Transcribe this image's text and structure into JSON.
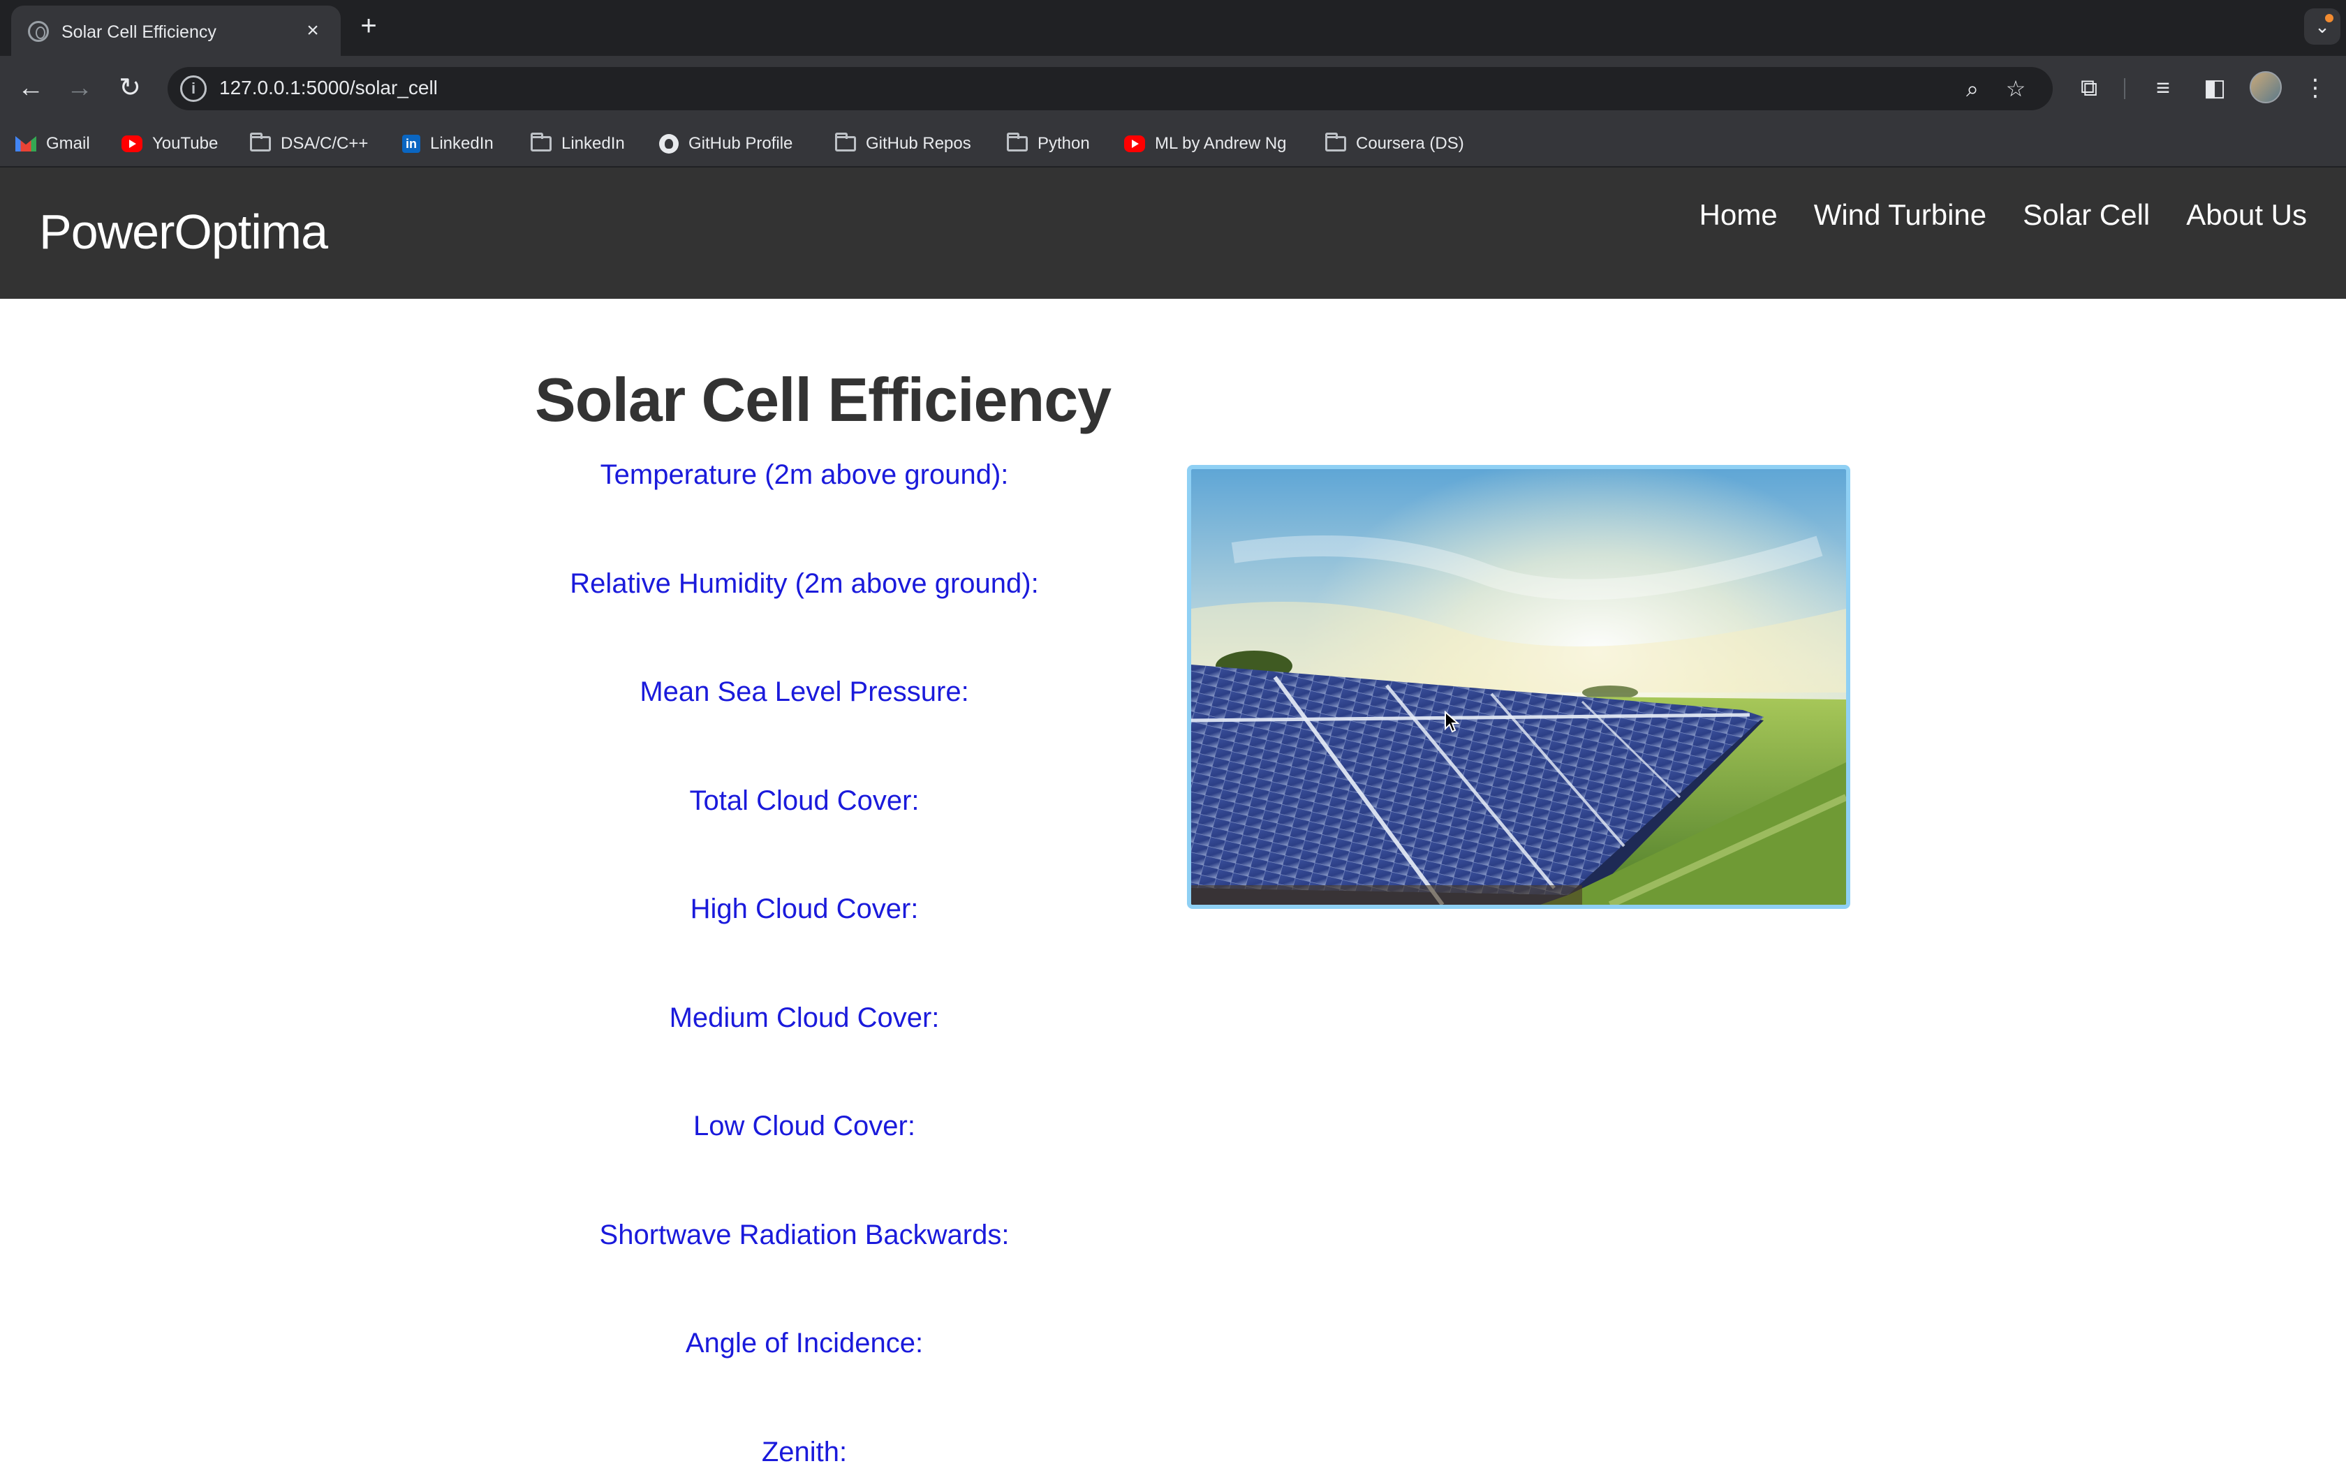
{
  "browser": {
    "tab": {
      "title": "Solar Cell Efficiency",
      "close": "×"
    },
    "new_tab": "+",
    "url": "127.0.0.1:5000/solar_cell",
    "bookmarks": [
      {
        "label": "Gmail",
        "icon": "gmail-icon"
      },
      {
        "label": "YouTube",
        "icon": "youtube-icon"
      },
      {
        "label": "DSA/C/C++",
        "icon": "folder-icon"
      },
      {
        "label": "LinkedIn",
        "icon": "linkedin-icon"
      },
      {
        "label": "LinkedIn",
        "icon": "folder-icon"
      },
      {
        "label": "GitHub Profile",
        "icon": "github-icon"
      },
      {
        "label": "GitHub Repos",
        "icon": "folder-icon"
      },
      {
        "label": "Python",
        "icon": "folder-icon"
      },
      {
        "label": "ML by Andrew Ng",
        "icon": "youtube-icon"
      },
      {
        "label": "Coursera (DS)",
        "icon": "folder-icon"
      }
    ]
  },
  "site": {
    "brand": "PowerOptima",
    "nav": [
      "Home",
      "Wind Turbine",
      "Solar Cell",
      "About Us"
    ]
  },
  "main": {
    "heading": "Solar Cell Efficiency",
    "fields": [
      "Temperature (2m above ground):",
      "Relative Humidity (2m above ground):",
      "Mean Sea Level Pressure:",
      "Total Cloud Cover:",
      "High Cloud Cover:",
      "Medium Cloud Cover:",
      "Low Cloud Cover:",
      "Shortwave Radiation Backwards:",
      "Angle of Incidence:",
      "Zenith:"
    ],
    "image": {
      "icon": "solar-panel-field-image"
    }
  },
  "colors": {
    "navbar": "#333333",
    "field_label": "#1a1adb",
    "image_border": "#8fd0f4"
  }
}
